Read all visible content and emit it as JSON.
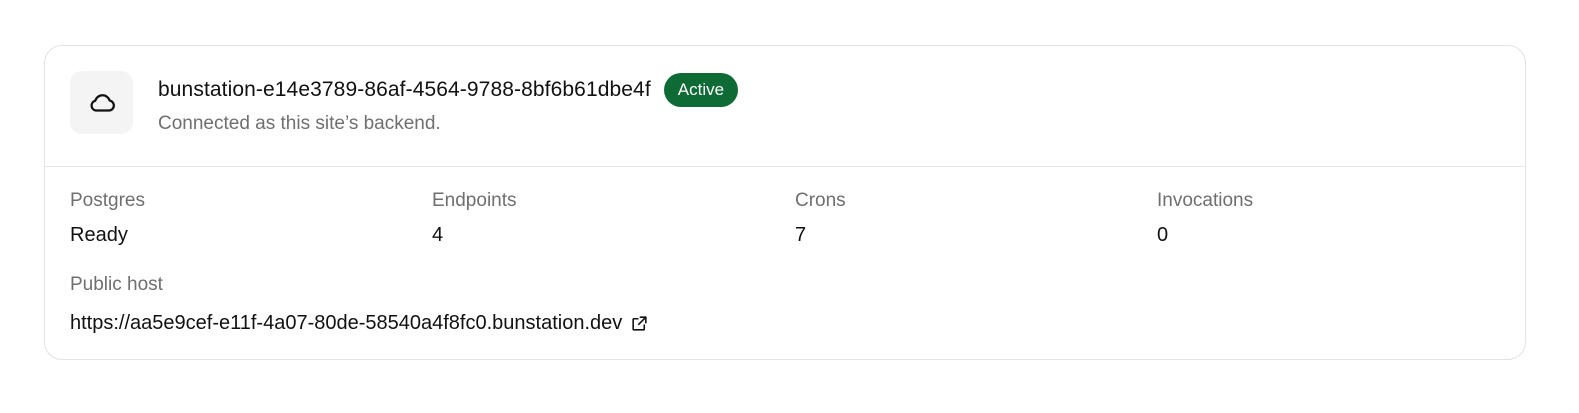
{
  "backend": {
    "icon": "cloud-icon",
    "name": "bunstation-e14e3789-86af-4564-9788-8bf6b61dbe4f",
    "status": "Active",
    "status_color": "#0f6b35",
    "description": "Connected as this site’s backend."
  },
  "stats": [
    {
      "label": "Postgres",
      "value": "Ready"
    },
    {
      "label": "Endpoints",
      "value": "4"
    },
    {
      "label": "Crons",
      "value": "7"
    },
    {
      "label": "Invocations",
      "value": "0"
    }
  ],
  "public_host": {
    "label": "Public host",
    "url": "https://aa5e9cef-e11f-4a07-80de-58540a4f8fc0.bunstation.dev",
    "icon": "external-link-icon"
  }
}
